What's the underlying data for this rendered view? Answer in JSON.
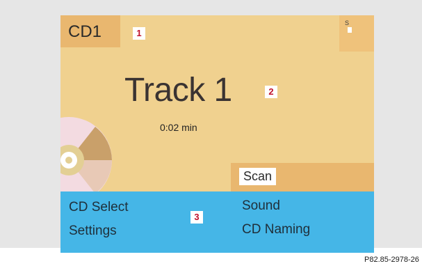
{
  "screen": {
    "source_label": "CD1",
    "track": {
      "title": "Track 1",
      "elapsed": "0:02 min"
    },
    "status": {
      "signal_label": "S"
    },
    "scan_button_label": "Scan",
    "menu": {
      "left": [
        "CD Select",
        "Settings"
      ],
      "right": [
        "Sound",
        "CD Naming"
      ]
    }
  },
  "callouts": [
    "1",
    "2",
    "3"
  ],
  "figure_ref": "P82.85-2978-26",
  "colors": {
    "screen_bg": "#f0d18f",
    "tab_bg": "#e9b76f",
    "menu_bg": "#45b6e7",
    "callout_text": "#c0102b"
  }
}
